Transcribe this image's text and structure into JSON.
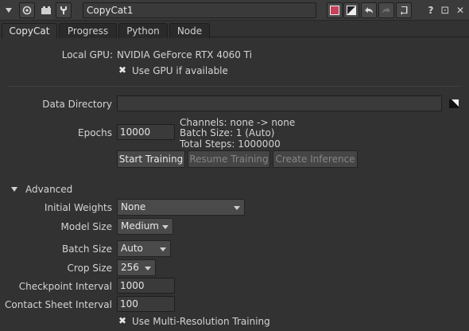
{
  "toolbar": {
    "node_name": "CopyCat1",
    "icons": [
      "collapse-triangle-icon",
      "settings-circle-icon",
      "camera-icon",
      "wrench-icon",
      "color-swatch-icon",
      "gray-swatch-icon",
      "undo-icon",
      "redo-icon",
      "revert-icon",
      "help-icon",
      "float-icon",
      "close-icon"
    ],
    "help_label": "?",
    "float_label": "⊡",
    "close_label": "✕"
  },
  "tabs": [
    "CopyCat",
    "Progress",
    "Python",
    "Node"
  ],
  "form": {
    "local_gpu_label": "Local GPU:",
    "local_gpu_value": "NVIDIA GeForce RTX 4060 Ti",
    "use_gpu_label": "Use GPU if available",
    "use_gpu_checked": true,
    "data_directory_label": "Data Directory",
    "data_directory_value": "",
    "epochs_label": "Epochs",
    "epochs_value": "10000",
    "channels_info": "Channels: none -> none",
    "batch_info": "Batch Size: 1 (Auto)",
    "steps_info": "Total Steps: 1000000",
    "start_training": "Start Training",
    "resume_training": "Resume Training",
    "create_inference": "Create Inference",
    "advanced_label": "Advanced",
    "initial_weights_label": "Initial Weights",
    "initial_weights_value": "None",
    "model_size_label": "Model Size",
    "model_size_value": "Medium",
    "batch_size_label": "Batch Size",
    "batch_size_value": "Auto",
    "crop_size_label": "Crop Size",
    "crop_size_value": "256",
    "checkpoint_interval_label": "Checkpoint Interval",
    "checkpoint_interval_value": "1000",
    "contact_sheet_interval_label": "Contact Sheet Interval",
    "contact_sheet_interval_value": "100",
    "multi_res_label": "Use Multi-Resolution Training",
    "multi_res_checked": true,
    "check_mark": "✖"
  },
  "colors": {
    "background": "#323232",
    "toolbar": "#3b3b3b",
    "field": "#3a3a3a",
    "button": "#484848",
    "accent_red": "#c8405a"
  }
}
